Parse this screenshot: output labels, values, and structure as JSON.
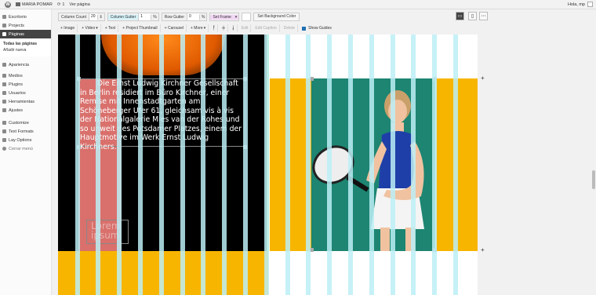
{
  "adminbar": {
    "site_name": "MARIA POMAR",
    "updates_count": "1",
    "view_page": "Ver página",
    "greeting": "Hola, mp"
  },
  "sidebar": {
    "items": [
      {
        "label": "Escritorio",
        "icon": "dashboard-icon"
      },
      {
        "label": "Projects",
        "icon": "projects-icon"
      },
      {
        "label": "Páginas",
        "icon": "pages-icon",
        "active": true
      },
      {
        "label": "Apariencia",
        "icon": "appearance-icon"
      },
      {
        "label": "Medios",
        "icon": "media-icon"
      },
      {
        "label": "Plugins",
        "icon": "plugins-icon"
      },
      {
        "label": "Usuarios",
        "icon": "users-icon"
      },
      {
        "label": "Herramientas",
        "icon": "tools-icon"
      },
      {
        "label": "Ajustes",
        "icon": "settings-icon"
      },
      {
        "label": "Customize",
        "icon": "customize-icon"
      },
      {
        "label": "Text Formats",
        "icon": "text-formats-icon"
      },
      {
        "label": "Lay Options",
        "icon": "lay-options-icon"
      },
      {
        "label": "Cerrar menú",
        "icon": "collapse-icon"
      }
    ],
    "submenu": {
      "all_pages": "Todas las páginas",
      "add_new": "Añadir nueva"
    }
  },
  "toolbar1": {
    "column_count_label": "Column Count",
    "column_count_value": "20",
    "column_gutter_label": "Column Gutter",
    "column_gutter_value": "1",
    "column_gutter_unit": "%",
    "row_gutter_label": "Row Gutter",
    "row_gutter_value": "0",
    "row_gutter_unit": "%",
    "set_frame": "Set Frame",
    "set_bg_color": "Set Background Color"
  },
  "toolbar2": {
    "image": "+ Image",
    "video": "+ Video",
    "text": "+ Text",
    "project_thumbnail": "+ Project Thumbnail",
    "carousel": "+ Carousel",
    "more": "+ More",
    "edit": "Edit",
    "edit_caption": "Edit Caption",
    "delete": "Delete",
    "show_guides": "Show Guides"
  },
  "canvas": {
    "text_block": "Die Ernst Ludwig Kirchner Gesellschaft in Berlin residiert im Büro Kirchner, einer Remise mit Innenstadtgarten am Schöneberger Ufer 61, gleichsam vis à vis der Nationalgalerie Mies van der Rohes und so unweit des Potsdamer Platzes, einem der Hauptmotive im Werk Ernst Ludwig Kirchners.",
    "lorem": "Lorem ipsum"
  },
  "colors": {
    "accent_yellow": "#f7b500",
    "guide_cyan": "#bceef6",
    "red_strip": "#d9706c",
    "photo_green": "#1f8a76"
  }
}
